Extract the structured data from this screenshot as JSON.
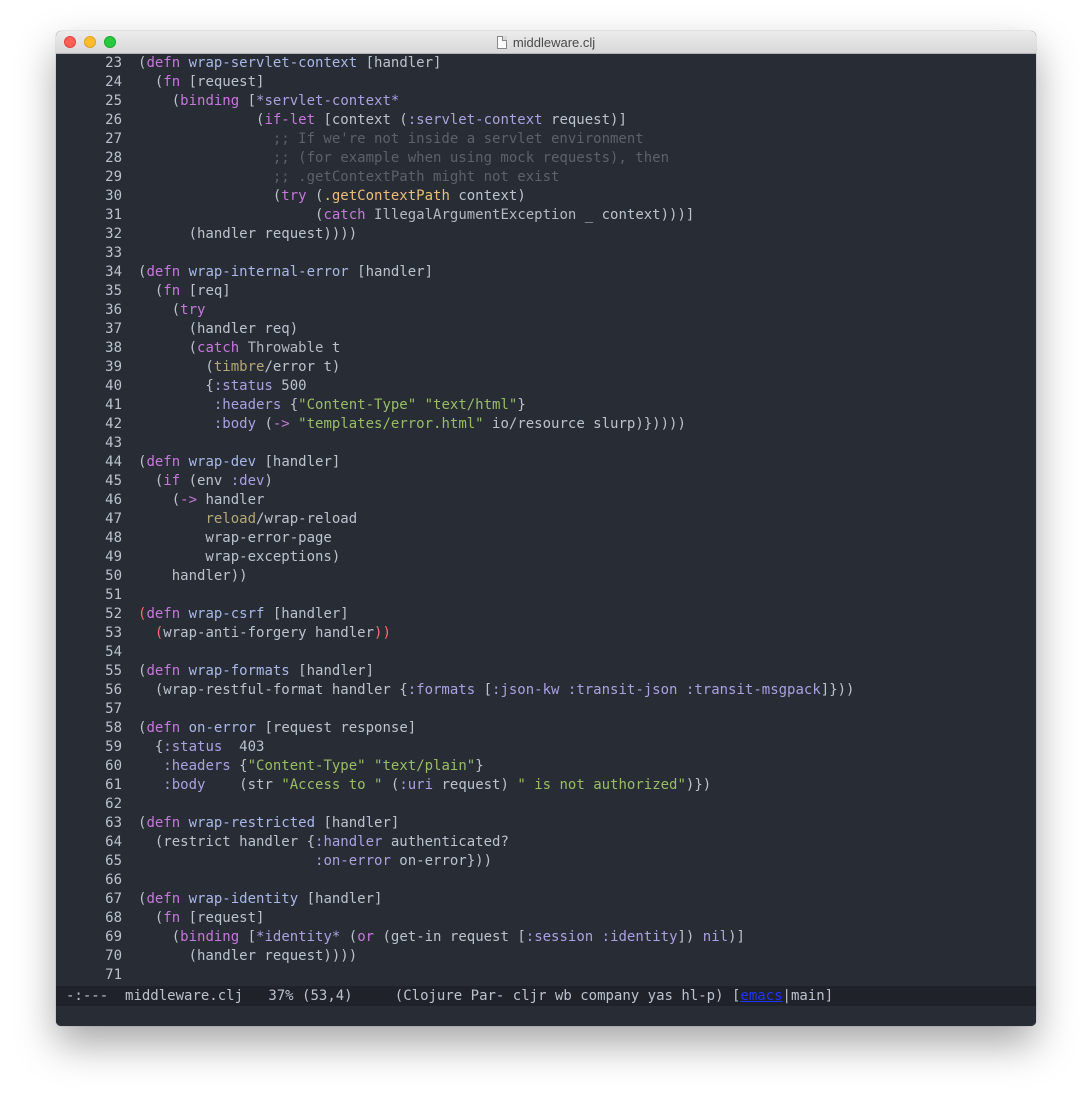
{
  "window": {
    "title": "middleware.clj"
  },
  "colors": {
    "default": "#bbc2cf",
    "keyword": "#c678dd",
    "fn_name": "#a8b8e8",
    "comment": "#5b6268",
    "string": "#98be65",
    "builtin": "#ecbe7b",
    "constant": "#a9a1e1",
    "type": "#b4b8bf",
    "param": "#e2c08d",
    "error": "#ff6c6b",
    "namespace": "#b4a77a"
  },
  "lines": [
    {
      "n": "23",
      "tokens": [
        [
          "(",
          "p"
        ],
        [
          "defn",
          "k"
        ],
        " ",
        [
          "wrap-servlet-context",
          "f"
        ],
        " [handler]"
      ]
    },
    {
      "n": "24",
      "tokens": [
        "  (",
        [
          "fn",
          "k"
        ],
        " [request]"
      ]
    },
    {
      "n": "25",
      "tokens": [
        "    (",
        [
          "binding",
          "k"
        ],
        " [",
        [
          "*servlet-context*",
          "c"
        ]
      ]
    },
    {
      "n": "26",
      "tokens": [
        "              (",
        [
          "if-let",
          "k"
        ],
        " [context (",
        [
          ":servlet-context",
          "c"
        ],
        " request)]"
      ]
    },
    {
      "n": "27",
      "tokens": [
        [
          "                ;; If we're not inside a servlet environment",
          "m"
        ]
      ]
    },
    {
      "n": "28",
      "tokens": [
        [
          "                ;; (for example when using mock requests), then",
          "m"
        ]
      ]
    },
    {
      "n": "29",
      "tokens": [
        [
          "                ;; .getContextPath might not exist",
          "m"
        ]
      ]
    },
    {
      "n": "30",
      "tokens": [
        "                (",
        [
          "try",
          "k"
        ],
        " (",
        [
          ".getContextPath",
          "b"
        ],
        " context)"
      ]
    },
    {
      "n": "31",
      "tokens": [
        "                     (",
        [
          "catch",
          "k"
        ],
        " ",
        [
          "IllegalArgumentException",
          "t"
        ],
        " _ context)))]"
      ]
    },
    {
      "n": "32",
      "tokens": [
        "      (handler request))))"
      ]
    },
    {
      "n": "33",
      "tokens": [
        ""
      ]
    },
    {
      "n": "34",
      "tokens": [
        "(",
        [
          "defn",
          "k"
        ],
        " ",
        [
          "wrap-internal-error",
          "f"
        ],
        " [handler]"
      ]
    },
    {
      "n": "35",
      "tokens": [
        "  (",
        [
          "fn",
          "k"
        ],
        " [req]"
      ]
    },
    {
      "n": "36",
      "tokens": [
        "    (",
        [
          "try",
          "k"
        ]
      ]
    },
    {
      "n": "37",
      "tokens": [
        "      (handler req)"
      ]
    },
    {
      "n": "38",
      "tokens": [
        "      (",
        [
          "catch",
          "k"
        ],
        " ",
        [
          "Throwable",
          "t"
        ],
        " t"
      ]
    },
    {
      "n": "39",
      "tokens": [
        "        (",
        [
          "timbre",
          "n"
        ],
        "/error t)"
      ]
    },
    {
      "n": "40",
      "tokens": [
        "        {",
        [
          ":status",
          "c"
        ],
        " 500"
      ]
    },
    {
      "n": "41",
      "tokens": [
        "         ",
        [
          ":headers",
          "c"
        ],
        " {",
        [
          "\"Content-Type\"",
          "s"
        ],
        " ",
        [
          "\"text/html\"",
          "s"
        ],
        "}"
      ]
    },
    {
      "n": "42",
      "tokens": [
        "         ",
        [
          ":body",
          "c"
        ],
        " (",
        [
          "->",
          "k"
        ],
        " ",
        [
          "\"templates/error.html\"",
          "s"
        ],
        " io/resource slurp)}))))"
      ]
    },
    {
      "n": "43",
      "tokens": [
        ""
      ]
    },
    {
      "n": "44",
      "tokens": [
        "(",
        [
          "defn",
          "k"
        ],
        " ",
        [
          "wrap-dev",
          "f"
        ],
        " [handler]"
      ]
    },
    {
      "n": "45",
      "tokens": [
        "  (",
        [
          "if",
          "k"
        ],
        " (env ",
        [
          ":dev",
          "c"
        ],
        ")"
      ]
    },
    {
      "n": "46",
      "tokens": [
        "    (",
        [
          "->",
          "k"
        ],
        " handler"
      ]
    },
    {
      "n": "47",
      "tokens": [
        "        ",
        [
          "reload",
          "n"
        ],
        "/wrap-reload"
      ]
    },
    {
      "n": "48",
      "tokens": [
        "        wrap-error-page"
      ]
    },
    {
      "n": "49",
      "tokens": [
        "        wrap-exceptions)"
      ]
    },
    {
      "n": "50",
      "tokens": [
        "    handler))"
      ]
    },
    {
      "n": "51",
      "tokens": [
        ""
      ]
    },
    {
      "n": "52",
      "tokens": [
        [
          "(",
          "e"
        ],
        [
          "defn",
          "k"
        ],
        " ",
        [
          "wrap-csrf",
          "f"
        ],
        " [handler]"
      ]
    },
    {
      "n": "53",
      "tokens": [
        "  ",
        [
          "(",
          "e"
        ],
        "wrap-anti-forgery handler",
        [
          "))",
          "e"
        ]
      ]
    },
    {
      "n": "54",
      "tokens": [
        ""
      ]
    },
    {
      "n": "55",
      "tokens": [
        "(",
        [
          "defn",
          "k"
        ],
        " ",
        [
          "wrap-formats",
          "f"
        ],
        " [handler]"
      ]
    },
    {
      "n": "56",
      "tokens": [
        "  (wrap-restful-format handler {",
        [
          ":formats",
          "c"
        ],
        " [",
        [
          ":json-kw",
          "c"
        ],
        " ",
        [
          ":transit-json",
          "c"
        ],
        " ",
        [
          ":transit-msgpack",
          "c"
        ],
        "]}))"
      ]
    },
    {
      "n": "57",
      "tokens": [
        ""
      ]
    },
    {
      "n": "58",
      "tokens": [
        "(",
        [
          "defn",
          "k"
        ],
        " ",
        [
          "on-error",
          "f"
        ],
        " [request response]"
      ]
    },
    {
      "n": "59",
      "tokens": [
        "  {",
        [
          ":status",
          "c"
        ],
        "  403"
      ]
    },
    {
      "n": "60",
      "tokens": [
        "   ",
        [
          ":headers",
          "c"
        ],
        " {",
        [
          "\"Content-Type\"",
          "s"
        ],
        " ",
        [
          "\"text/plain\"",
          "s"
        ],
        "}"
      ]
    },
    {
      "n": "61",
      "tokens": [
        "   ",
        [
          ":body",
          "c"
        ],
        "    (str ",
        [
          "\"Access to \"",
          "s"
        ],
        " (",
        [
          ":uri",
          "c"
        ],
        " request) ",
        [
          "\" is not authorized\"",
          "s"
        ],
        ")})"
      ]
    },
    {
      "n": "62",
      "tokens": [
        ""
      ]
    },
    {
      "n": "63",
      "tokens": [
        "(",
        [
          "defn",
          "k"
        ],
        " ",
        [
          "wrap-restricted",
          "f"
        ],
        " [handler]"
      ]
    },
    {
      "n": "64",
      "tokens": [
        "  (restrict handler {",
        [
          ":handler",
          "c"
        ],
        " authenticated?"
      ]
    },
    {
      "n": "65",
      "tokens": [
        "                     ",
        [
          ":on-error",
          "c"
        ],
        " on-error}))"
      ]
    },
    {
      "n": "66",
      "tokens": [
        ""
      ]
    },
    {
      "n": "67",
      "tokens": [
        "(",
        [
          "defn",
          "k"
        ],
        " ",
        [
          "wrap-identity",
          "f"
        ],
        " [handler]"
      ]
    },
    {
      "n": "68",
      "tokens": [
        "  (",
        [
          "fn",
          "k"
        ],
        " [request]"
      ]
    },
    {
      "n": "69",
      "tokens": [
        "    (",
        [
          "binding",
          "k"
        ],
        " [",
        [
          "*identity*",
          "c"
        ],
        " (",
        [
          "or",
          "k"
        ],
        " (get-in request [",
        [
          ":session",
          "c"
        ],
        " ",
        [
          ":identity",
          "c"
        ],
        "]) ",
        [
          "nil",
          "c"
        ],
        ")]"
      ]
    },
    {
      "n": "70",
      "tokens": [
        "      (handler request))))"
      ]
    },
    {
      "n": "71",
      "tokens": [
        ""
      ]
    }
  ],
  "modeline": {
    "status": "-:---",
    "buffer": "middleware.clj",
    "position": "37% (53,4)",
    "modes": "(Clojure Par- cljr wb company yas hl-p)",
    "branch_open": "[",
    "branch_emacs": "emacs",
    "branch_sep": "|",
    "branch_main": "main]"
  }
}
